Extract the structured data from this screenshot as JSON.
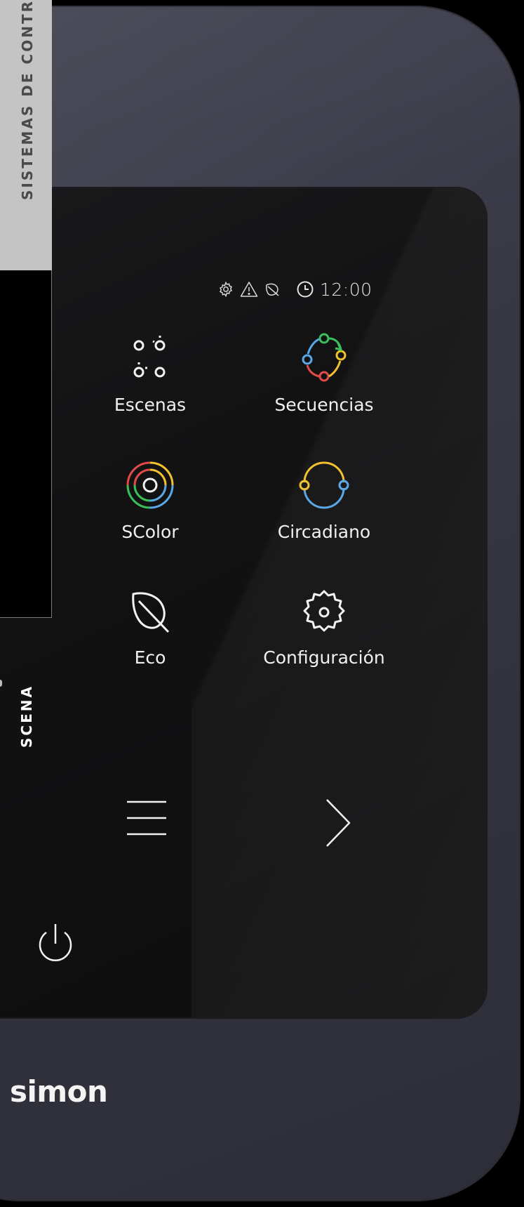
{
  "side_labels": {
    "top": "SISTEMAS DE CONTR",
    "current": "SCENA"
  },
  "status_bar": {
    "icons": [
      "gear-icon",
      "warning-icon",
      "eco-off-icon",
      "clock-icon"
    ],
    "time": "12:00"
  },
  "menu": {
    "items": [
      {
        "label": "Escenas",
        "icon": "scenes-icon"
      },
      {
        "label": "Secuencias",
        "icon": "sequences-icon"
      },
      {
        "label": "SColor",
        "icon": "scolor-icon"
      },
      {
        "label": "Circadiano",
        "icon": "circadian-icon"
      },
      {
        "label": "Eco",
        "icon": "leaf-icon"
      },
      {
        "label": "Configuración",
        "icon": "settings-icon"
      }
    ]
  },
  "controls": {
    "menu": "hamburger-icon",
    "next": "chevron-right-icon",
    "power": "power-icon"
  },
  "brand": {
    "name": "simon"
  },
  "colors": {
    "screen": "#121213",
    "device": "#3a3a47",
    "accent_green": "#3bbf5a",
    "accent_yellow": "#f2c12e",
    "accent_red": "#e24a4a",
    "accent_blue": "#5aa7e6"
  }
}
